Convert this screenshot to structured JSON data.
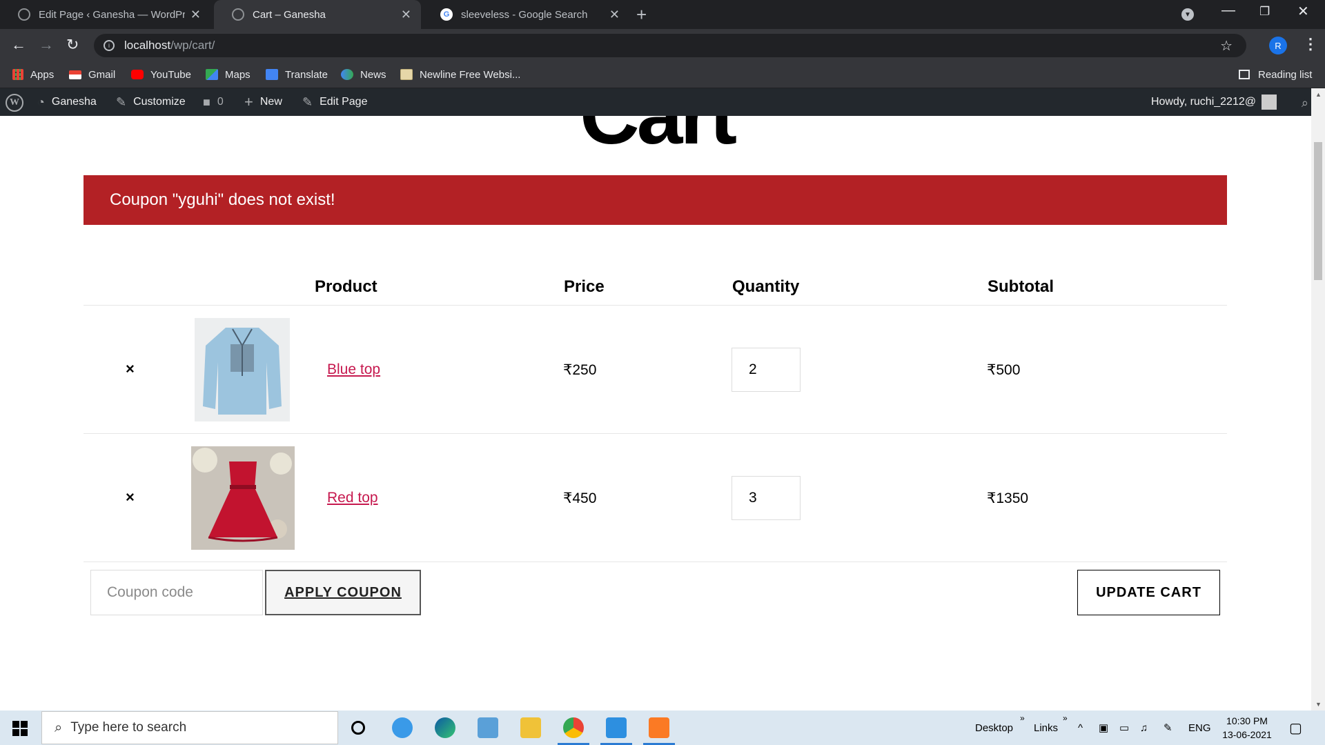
{
  "browser": {
    "tabs": [
      {
        "title": "Edit Page ‹ Ganesha — WordPress",
        "active": false
      },
      {
        "title": "Cart – Ganesha",
        "active": true
      },
      {
        "title": "sleeveless - Google Search",
        "active": false
      }
    ],
    "url_host": "localhost",
    "url_path": "/wp/cart/",
    "profile_initial": "R",
    "bookmarks": [
      "Apps",
      "Gmail",
      "YouTube",
      "Maps",
      "Translate",
      "News",
      "Newline Free Websi..."
    ],
    "reading_list": "Reading list"
  },
  "admin_bar": {
    "site": "Ganesha",
    "customize": "Customize",
    "comments": "0",
    "new": "New",
    "edit_page": "Edit Page",
    "howdy": "Howdy, ruchi_2212@"
  },
  "page": {
    "title": "Cart",
    "notice": "Coupon \"yguhi\" does not exist!",
    "columns": [
      "Product",
      "Price",
      "Quantity",
      "Subtotal"
    ],
    "items": [
      {
        "name": "Blue top",
        "price": "₹250",
        "quantity": "2",
        "subtotal": "₹500"
      },
      {
        "name": "Red top",
        "price": "₹450",
        "quantity": "3",
        "subtotal": "₹1350"
      }
    ],
    "coupon_placeholder": "Coupon code",
    "apply_coupon": "APPLY COUPON",
    "update_cart": "UPDATE CART",
    "remove_symbol": "×"
  },
  "taskbar": {
    "search_placeholder": "Type here to search",
    "desktop": "Desktop",
    "links": "Links",
    "language": "ENG",
    "time": "10:30 PM",
    "date": "13-06-2021"
  },
  "colors": {
    "notice_bg": "#b32125",
    "link": "#c6184e",
    "admin_bar": "#23282d"
  }
}
